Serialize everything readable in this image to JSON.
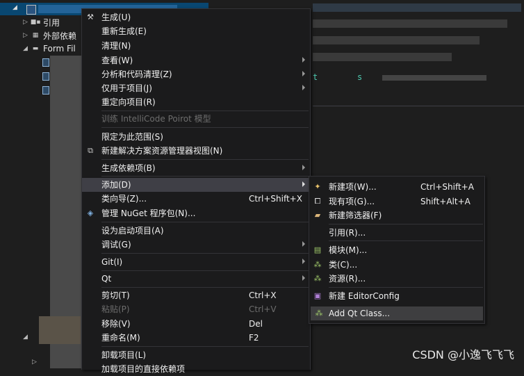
{
  "explorer": {
    "rows": [
      {
        "label": "引用",
        "icon": "reference-icon"
      },
      {
        "label": "外部依赖",
        "icon": "external-deps-icon"
      },
      {
        "label": "Form Fil",
        "icon": "folder-icon"
      }
    ],
    "code_hint_1": "t",
    "code_hint_2": "s"
  },
  "context_menu": {
    "items": [
      {
        "label": "生成(U)",
        "icon": "build-icon",
        "submenu": false
      },
      {
        "label": "重新生成(E)",
        "submenu": false
      },
      {
        "label": "清理(N)",
        "submenu": false
      },
      {
        "label": "查看(W)",
        "submenu": true
      },
      {
        "label": "分析和代码清理(Z)",
        "submenu": true
      },
      {
        "label": "仅用于项目(J)",
        "submenu": true
      },
      {
        "label": "重定向项目(R)",
        "submenu": false
      },
      {
        "label": "训练 IntelliCode Poirot 模型",
        "disabled": true
      },
      {
        "label": "限定为此范围(S)"
      },
      {
        "label": "新建解决方案资源管理器视图(N)",
        "icon": "new-view-icon"
      },
      {
        "label": "生成依赖项(B)",
        "submenu": true
      },
      {
        "label": "添加(D)",
        "submenu": true,
        "highlighted": true
      },
      {
        "label": "类向导(Z)...",
        "shortcut": "Ctrl+Shift+X"
      },
      {
        "label": "管理 NuGet 程序包(N)...",
        "icon": "nuget-icon"
      },
      {
        "label": "设为启动项目(A)"
      },
      {
        "label": "调试(G)",
        "submenu": true
      },
      {
        "label": "Git(I)",
        "submenu": true
      },
      {
        "label": "Qt",
        "submenu": true
      },
      {
        "label": "剪切(T)",
        "shortcut": "Ctrl+X"
      },
      {
        "label": "粘贴(P)",
        "shortcut": "Ctrl+V",
        "disabled": true
      },
      {
        "label": "移除(V)",
        "shortcut": "Del"
      },
      {
        "label": "重命名(M)",
        "shortcut": "F2"
      },
      {
        "label": "卸载项目(L)"
      },
      {
        "label": "加载项目的直接依赖项"
      }
    ]
  },
  "add_submenu": {
    "items": [
      {
        "label": "新建项(W)...",
        "shortcut": "Ctrl+Shift+A",
        "icon": "new-item-icon"
      },
      {
        "label": "现有项(G)...",
        "shortcut": "Shift+Alt+A",
        "icon": "existing-item-icon"
      },
      {
        "label": "新建筛选器(F)",
        "icon": "new-filter-icon"
      },
      {
        "label": "引用(R)..."
      },
      {
        "label": "模块(M)...",
        "icon": "module-icon"
      },
      {
        "label": "类(C)...",
        "icon": "class-icon"
      },
      {
        "label": "资源(R)...",
        "icon": "resource-icon"
      },
      {
        "label": "新建 EditorConfig",
        "icon": "editorconfig-icon"
      },
      {
        "label": "Add Qt Class...",
        "icon": "qt-class-icon",
        "highlighted": true
      }
    ]
  },
  "watermark": "CSDN @小逸飞飞飞",
  "colors": {
    "menu_bg": "#1b1b1c",
    "highlight": "#3f3f46",
    "selection": "#094771",
    "text": "#f1f1f1",
    "disabled_text": "#6d6d6d"
  }
}
